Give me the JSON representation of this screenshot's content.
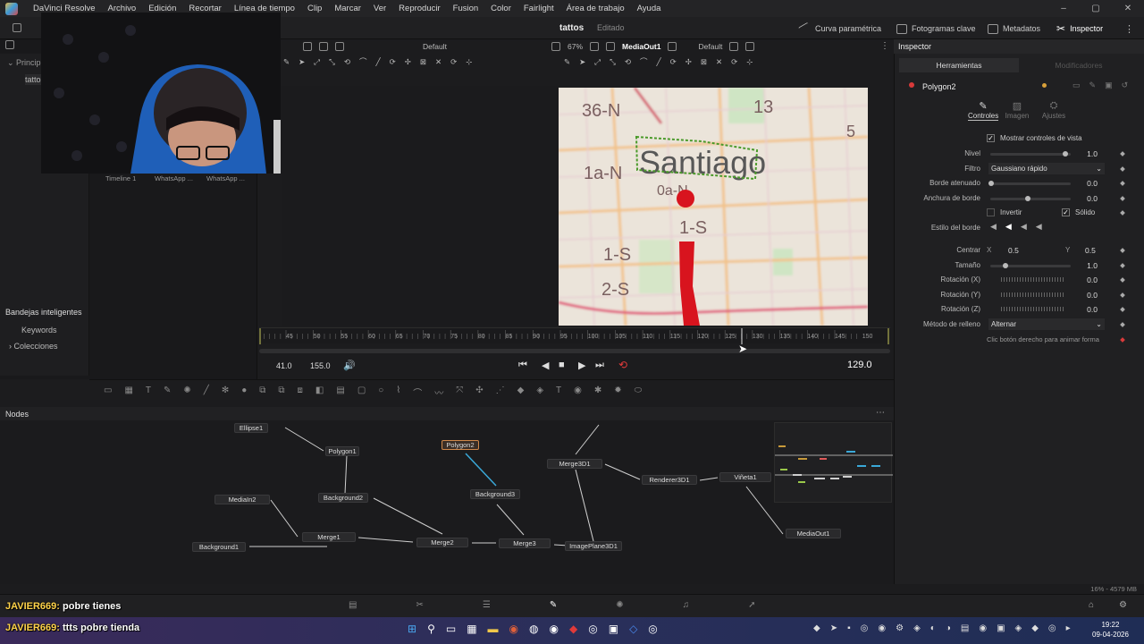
{
  "menubar": {
    "app_title": "DaVinci Resolve",
    "items": [
      "Archivo",
      "Edición",
      "Recortar",
      "Línea de tiempo",
      "Clip",
      "Marcar",
      "Ver",
      "Reproducir",
      "Fusion",
      "Color",
      "Fairlight",
      "Área de trabajo",
      "Ayuda"
    ]
  },
  "project": {
    "name": "tattos",
    "status": "Editado"
  },
  "top_toolbar": {
    "curva": "Curva paramétrica",
    "fotogramas": "Fotogramas clave",
    "metadatos": "Metadatos",
    "inspector": "Inspector"
  },
  "media_pool": {
    "header": "Princip",
    "bin": "tattos",
    "thumbs": [
      "Timeline 1",
      "WhatsApp ...",
      "WhatsApp ..."
    ],
    "smart_bins": "Bandejas inteligentes",
    "keywords": "Keywords",
    "collections": "Colecciones"
  },
  "viewer_left": {
    "preset": "Default"
  },
  "viewer_right": {
    "zoom": "67%",
    "node_name": "MediaOut1",
    "preset": "Default"
  },
  "ruler": {
    "ticks": [
      "45",
      "50",
      "55",
      "60",
      "65",
      "70",
      "75",
      "80",
      "85",
      "90",
      "95",
      "100",
      "105",
      "110",
      "115",
      "120",
      "125",
      "130",
      "135",
      "140",
      "145",
      "150"
    ]
  },
  "transport": {
    "start": "41.0",
    "end": "155.0",
    "current": "129.0"
  },
  "video_frame": {
    "map_text": "Santiago",
    "labels": [
      "36-N",
      "1a-N",
      "0a-N",
      "1-S",
      "1-S",
      "2-S",
      "13",
      "5"
    ]
  },
  "inspector": {
    "header": "Inspector",
    "tabs": [
      "Herramientas",
      "Modificadores"
    ],
    "tool_name": "Polygon2",
    "subtabs": [
      "Controles",
      "Imagen",
      "Ajustes"
    ],
    "show_controls": "Mostrar controles de vista",
    "rows": {
      "nivel": {
        "label": "Nivel",
        "value": "1.0"
      },
      "filtro": {
        "label": "Filtro",
        "value": "Gaussiano rápido"
      },
      "borde_atenuado": {
        "label": "Borde atenuado",
        "value": "0.0"
      },
      "anchura_borde": {
        "label": "Anchura de borde",
        "value": "0.0"
      },
      "invertir": "Invertir",
      "solido": "Sólido",
      "estilo_borde": "Estilo del borde",
      "centrar": {
        "label": "Centrar",
        "x_label": "X",
        "x": "0.5",
        "y_label": "Y",
        "y": "0.5"
      },
      "tamano": {
        "label": "Tamaño",
        "value": "1.0"
      },
      "rot_x": {
        "label": "Rotación (X)",
        "value": "0.0"
      },
      "rot_y": {
        "label": "Rotación (Y)",
        "value": "0.0"
      },
      "rot_z": {
        "label": "Rotación (Z)",
        "value": "0.0"
      },
      "metodo": {
        "label": "Método de relleno",
        "value": "Alternar"
      },
      "hint": "Clic botón derecho para animar forma"
    }
  },
  "nodes_panel": {
    "header": "Nodes",
    "nodes": {
      "ellipse1": "Ellipse1",
      "polygon1": "Polygon1",
      "polygon2": "Polygon2",
      "background2": "Background2",
      "background3": "Background3",
      "mediain2": "MediaIn2",
      "merge1": "Merge1",
      "merge2": "Merge2",
      "merge3": "Merge3",
      "background1": "Background1",
      "merge3d1": "Merge3D1",
      "renderer3d1": "Renderer3D1",
      "vineta1": "Viñeta1",
      "imageplane3d1": "ImagePlane3D1",
      "mediaout1": "MediaOut1"
    }
  },
  "status": {
    "memory": "16% - 4579 MB"
  },
  "chat": [
    {
      "user": "JAVIER669:",
      "msg": "pobre tienes"
    },
    {
      "user": "JAVIER669:",
      "msg": "ttts pobre tienda"
    }
  ],
  "taskbar": {
    "time": "19:22",
    "date": "09-04-2026"
  }
}
